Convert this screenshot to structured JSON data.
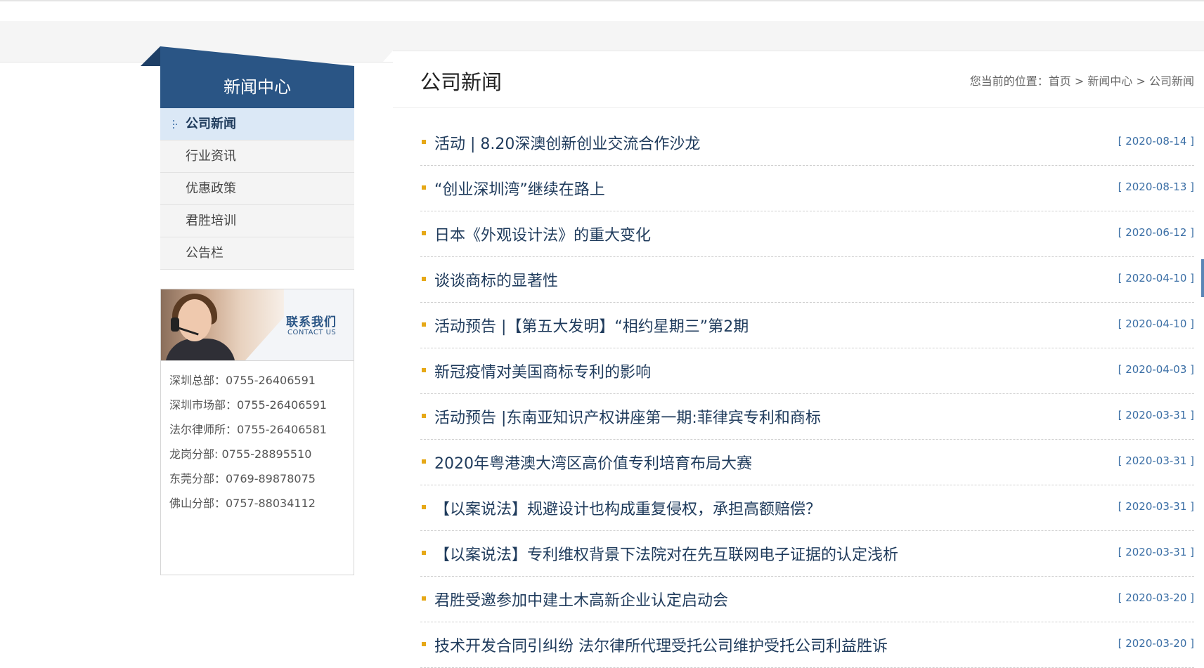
{
  "sidebar": {
    "title": "新闻中心",
    "items": [
      {
        "label": "公司新闻"
      },
      {
        "label": "行业资讯"
      },
      {
        "label": "优惠政策"
      },
      {
        "label": "君胜培训"
      },
      {
        "label": "公告栏"
      }
    ]
  },
  "contact": {
    "banner_title": "联系我们",
    "banner_subtitle": "CONTACT US",
    "lines": [
      "深圳总部：0755-26406591",
      "深圳市场部：0755-26406591",
      "法尔律师所：0755-26406581",
      "龙岗分部:  0755-28895510",
      "东莞分部：0769-89878075",
      "佛山分部：0757-88034112"
    ]
  },
  "main": {
    "title": "公司新闻",
    "breadcrumb": {
      "prefix": "您当前的位置：",
      "home": "首页",
      "sep": " > ",
      "section": "新闻中心",
      "current": "公司新闻"
    },
    "news": [
      {
        "title": "活动 | 8.20深澳创新创业交流合作沙龙",
        "date": "[ 2020-08-14 ]"
      },
      {
        "title": "“创业深圳湾”继续在路上",
        "date": "[ 2020-08-13 ]"
      },
      {
        "title": "日本《外观设计法》的重大变化",
        "date": "[ 2020-06-12 ]"
      },
      {
        "title": "谈谈商标的显著性",
        "date": "[ 2020-04-10 ]"
      },
      {
        "title": "活动预告 |【第五大发明】“相约星期三”第2期",
        "date": "[ 2020-04-10 ]"
      },
      {
        "title": "新冠疫情对美国商标专利的影响",
        "date": "[ 2020-04-03 ]"
      },
      {
        "title": "活动预告 |东南亚知识产权讲座第一期:菲律宾专利和商标",
        "date": "[ 2020-03-31 ]"
      },
      {
        "title": "2020年粤港澳大湾区高价值专利培育布局大赛",
        "date": "[ 2020-03-31 ]"
      },
      {
        "title": "【以案说法】规避设计也构成重复侵权，承担高额赔偿？",
        "date": "[ 2020-03-31 ]"
      },
      {
        "title": "【以案说法】专利维权背景下法院对在先互联网电子证据的认定浅析",
        "date": "[ 2020-03-31 ]"
      },
      {
        "title": "君胜受邀参加中建土木高新企业认定启动会",
        "date": "[ 2020-03-20 ]"
      },
      {
        "title": "技术开发合同引纠纷 法尔律所代理受托公司维护受托公司利益胜诉",
        "date": "[ 2020-03-20 ]"
      }
    ]
  },
  "colors": {
    "brand": "#2a5585",
    "active_bg": "#dbe8f6",
    "bullet": "#e6a817",
    "date": "#3a6ea5"
  }
}
